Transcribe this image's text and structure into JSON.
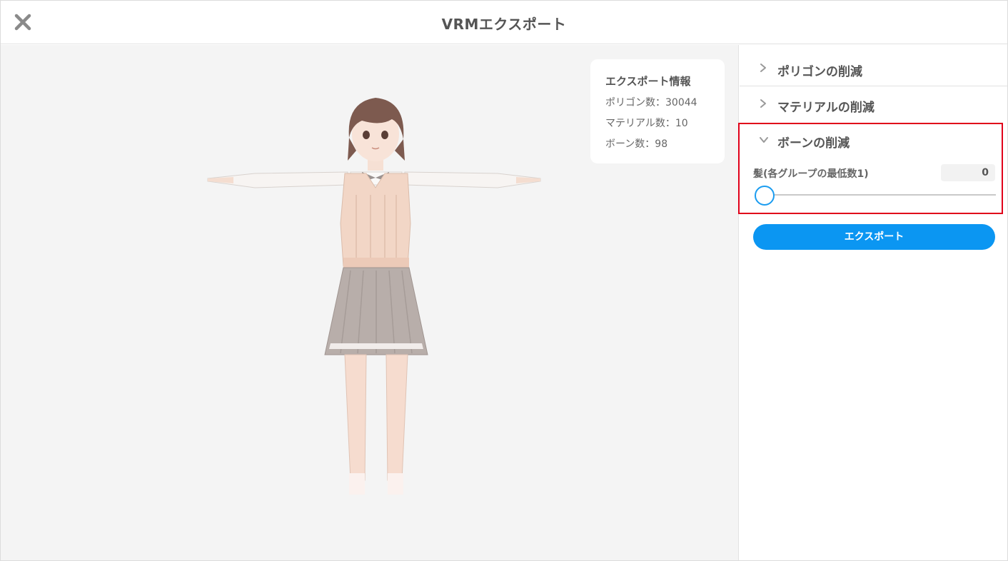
{
  "window": {
    "title": "VRMエクスポート"
  },
  "info_card": {
    "title": "エクスポート情報",
    "polygon_count": "ポリゴン数：30044",
    "material_count": "マテリアル数：10",
    "bone_count": "ボーン数：98"
  },
  "panel": {
    "sections": [
      {
        "label": "ポリゴンの削減",
        "expanded": false
      },
      {
        "label": "マテリアルの削減",
        "expanded": false
      },
      {
        "label": "ボーンの削減",
        "expanded": true
      }
    ],
    "bone_reduction": {
      "hair_label": "髪(各グループの最低数1)",
      "hair_value": "0",
      "slider_level": 0
    },
    "export_button_label": "エクスポート"
  },
  "colors": {
    "accent": "#0b96f2",
    "highlight_border": "#e0001a",
    "viewport_bg": "#f4f4f4"
  },
  "icons": {
    "close": "close-icon",
    "collapsed": "chevron-right-icon",
    "expanded": "chevron-down-icon"
  }
}
